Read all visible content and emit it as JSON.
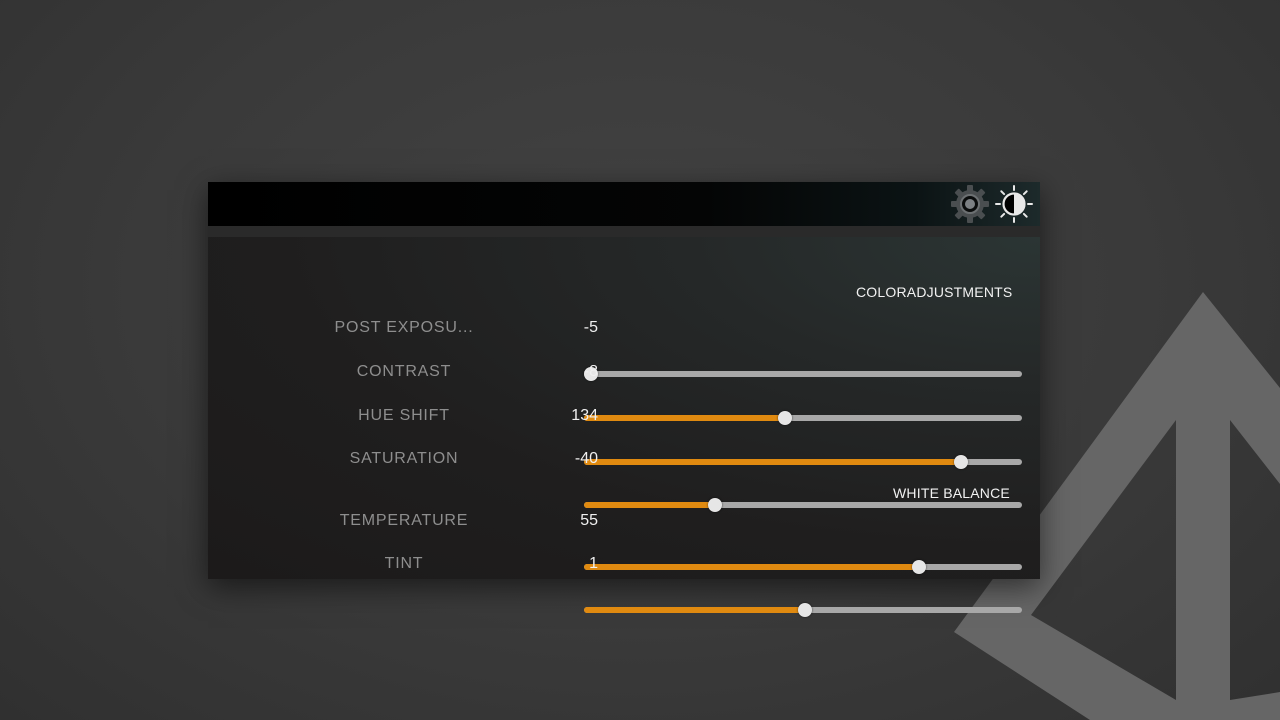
{
  "colors": {
    "accent": "#e08a10",
    "track": "#a8a8a8",
    "thumb": "#e6e6e6",
    "label": "#8e8e8e",
    "value": "#f0f0f0"
  },
  "toolbar": {
    "icons": [
      "gear-icon",
      "brightness-contrast-icon"
    ]
  },
  "sections": {
    "color_adjustments": "COLORADJUSTMENTS",
    "white_balance": "WHITE BALANCE"
  },
  "rows": [
    {
      "label": "POST EXPOSU...",
      "value": "-5",
      "level": 0.0
    },
    {
      "label": "CONTRAST",
      "value": "-8",
      "level": 0.46
    },
    {
      "label": "HUE SHIFT",
      "value": "134",
      "level": 0.86
    },
    {
      "label": "SATURATION",
      "value": "-40",
      "level": 0.3
    },
    {
      "label": "TEMPERATURE",
      "value": "55",
      "level": 0.765
    },
    {
      "label": "TINT",
      "value": "1",
      "level": 0.505
    }
  ]
}
